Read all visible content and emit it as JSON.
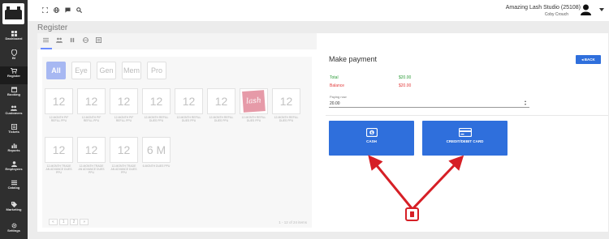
{
  "sidebar": {
    "items": [
      {
        "label": "Dashboard",
        "icon": "dashboard-icon"
      },
      {
        "label": "BI",
        "icon": "bi-pin-icon"
      },
      {
        "label": "Register",
        "icon": "cart-icon",
        "active": true
      },
      {
        "label": "Booking",
        "icon": "booking-icon"
      },
      {
        "label": "Customers",
        "icon": "customers-icon"
      },
      {
        "label": "Tickets",
        "icon": "tickets-icon"
      },
      {
        "label": "Reports",
        "icon": "reports-icon"
      },
      {
        "label": "Employees",
        "icon": "employees-icon"
      },
      {
        "label": "Catalog",
        "icon": "catalog-icon"
      },
      {
        "label": "Marketing",
        "icon": "marketing-icon"
      },
      {
        "label": "Settings",
        "icon": "settings-icon"
      }
    ]
  },
  "header": {
    "studio": "Amazing Lash Studio (25108)",
    "user": "Coby Crouch"
  },
  "page": {
    "title": "Register"
  },
  "register": {
    "filters": [
      {
        "label": "All",
        "selected": true
      },
      {
        "label": "Eye"
      },
      {
        "label": "Gen"
      },
      {
        "label": "Mem"
      },
      {
        "label": "Pro"
      }
    ],
    "products": [
      {
        "value": "12",
        "caption": "12-MONTH PIF REFILL PPU"
      },
      {
        "value": "12",
        "caption": "12-MONTH PIF REFILL PPU"
      },
      {
        "value": "12",
        "caption": "12-MONTH PIF REFILL PPU"
      },
      {
        "value": "12",
        "caption": "12-MONTH REFILL DUES PPU"
      },
      {
        "value": "12",
        "caption": "12-MONTH REFILL DUES PPU"
      },
      {
        "value": "12",
        "caption": "12-MONTH REFILL DUES PPU"
      },
      {
        "value": "lash",
        "caption": "12-MONTH REFILL DUES PPU",
        "logo": true
      },
      {
        "value": "12",
        "caption": "12-MONTH REFILL DUES PPU"
      },
      {
        "value": "12",
        "caption": "12-MONTH TRADE AN ADVANCE DUES PPU"
      },
      {
        "value": "12",
        "caption": "12-MONTH TRADE AN ADVANCE DUES PPU"
      },
      {
        "value": "12",
        "caption": "12-MONTH TRADE AN ADVANCE DUES PPU"
      },
      {
        "value": "6 M",
        "caption": "6-MONTH DUES PPU"
      }
    ],
    "pager": {
      "prev": "«",
      "page1": "1",
      "page2": "2",
      "next": "»"
    },
    "showing": "1 - 12 of 24 items"
  },
  "payment": {
    "title": "Make payment",
    "back_label": "BACK",
    "total_label": "Total",
    "total_value": "$20.00",
    "balance_label": "Balance",
    "balance_value": "$20.00",
    "paying_now_label": "Paying now",
    "paying_now_value": "20.00",
    "cash_label": "CASH",
    "card_label": "CREDIT/DEBIT CARD"
  },
  "colors": {
    "accent": "#2f6fdc",
    "total_green": "#2e9c3a",
    "balance_red": "#e23b3b",
    "annotation_red": "#d61f26",
    "sidebar_bg": "#2f2f2f"
  }
}
